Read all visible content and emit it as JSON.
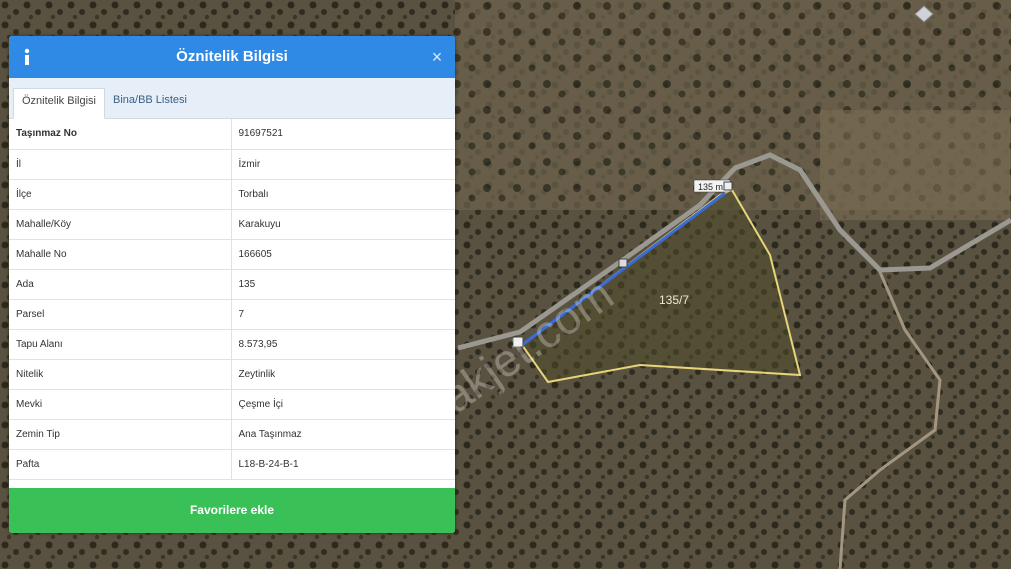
{
  "panel": {
    "title": "Öznitelik Bilgisi",
    "close_label": "×",
    "tabs": [
      {
        "label": "Öznitelik Bilgisi",
        "active": true
      },
      {
        "label": "Bina/BB Listesi",
        "active": false
      }
    ],
    "rows": [
      {
        "key": "Taşınmaz No",
        "value": "91697521"
      },
      {
        "key": "İl",
        "value": "İzmir"
      },
      {
        "key": "İlçe",
        "value": "Torbalı"
      },
      {
        "key": "Mahalle/Köy",
        "value": "Karakuyu"
      },
      {
        "key": "Mahalle No",
        "value": "166605"
      },
      {
        "key": "Ada",
        "value": "135"
      },
      {
        "key": "Parsel",
        "value": "7"
      },
      {
        "key": "Tapu Alanı",
        "value": "8.573,95"
      },
      {
        "key": "Nitelik",
        "value": "Zeytinlik"
      },
      {
        "key": "Mevki",
        "value": "Çeşme İçi"
      },
      {
        "key": "Zemin Tip",
        "value": "Ana Taşınmaz"
      },
      {
        "key": "Pafta",
        "value": "L18-B-24-B-1"
      }
    ],
    "favorite_button": "Favorilere ekle"
  },
  "map": {
    "parcel_label": "135/7",
    "road_label": "135 m",
    "watermark": "emlakjet.com"
  },
  "colors": {
    "header": "#2f8ae6",
    "favorite_button": "#39c157",
    "parcel_outline": "#e6d57a",
    "parcel_edge": "#3a6cd9"
  }
}
